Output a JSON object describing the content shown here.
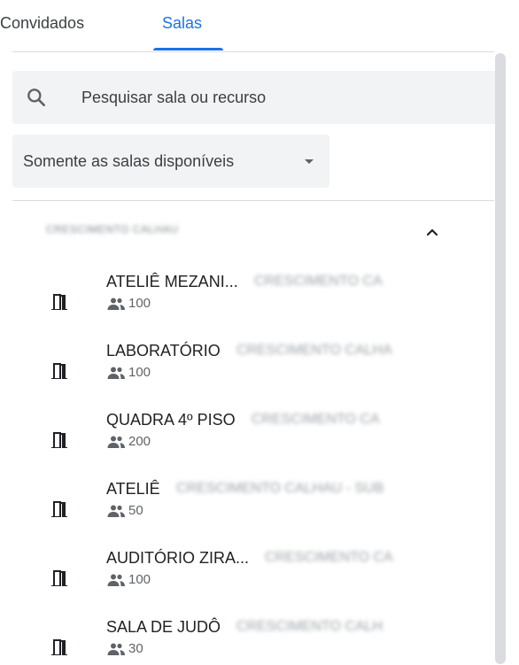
{
  "tabs": [
    {
      "label": "Convidados",
      "active": false
    },
    {
      "label": "Salas",
      "active": true
    }
  ],
  "search": {
    "placeholder": "Pesquisar sala ou recurso",
    "value": "",
    "icon": "search-icon"
  },
  "filter": {
    "selected": "Somente as salas disponíveis",
    "icon": "arrow-drop-down-icon"
  },
  "group": {
    "name": "CRESCIMENTO CALHAU",
    "expanded": true,
    "icon": "chevron-up-icon"
  },
  "rooms": [
    {
      "name": "ATELIÊ MEZANI...",
      "building": "CRESCIMENTO CA",
      "capacity": "100"
    },
    {
      "name": "LABORATÓRIO",
      "building": "CRESCIMENTO CALHA",
      "capacity": "100"
    },
    {
      "name": "QUADRA 4º PISO",
      "building": "CRESCIMENTO CA",
      "capacity": "200"
    },
    {
      "name": "ATELIÊ",
      "building": "CRESCIMENTO CALHAU - SUB",
      "capacity": "50"
    },
    {
      "name": "AUDITÓRIO ZIRA...",
      "building": "CRESCIMENTO CA",
      "capacity": "100"
    },
    {
      "name": "SALA DE JUDÔ",
      "building": "CRESCIMENTO CALH",
      "capacity": "30"
    }
  ],
  "colors": {
    "accent": "#1a73e8",
    "field_bg": "#f1f3f4",
    "divider": "#dadce0",
    "text_primary": "#202124",
    "text_secondary": "#5f6368"
  }
}
